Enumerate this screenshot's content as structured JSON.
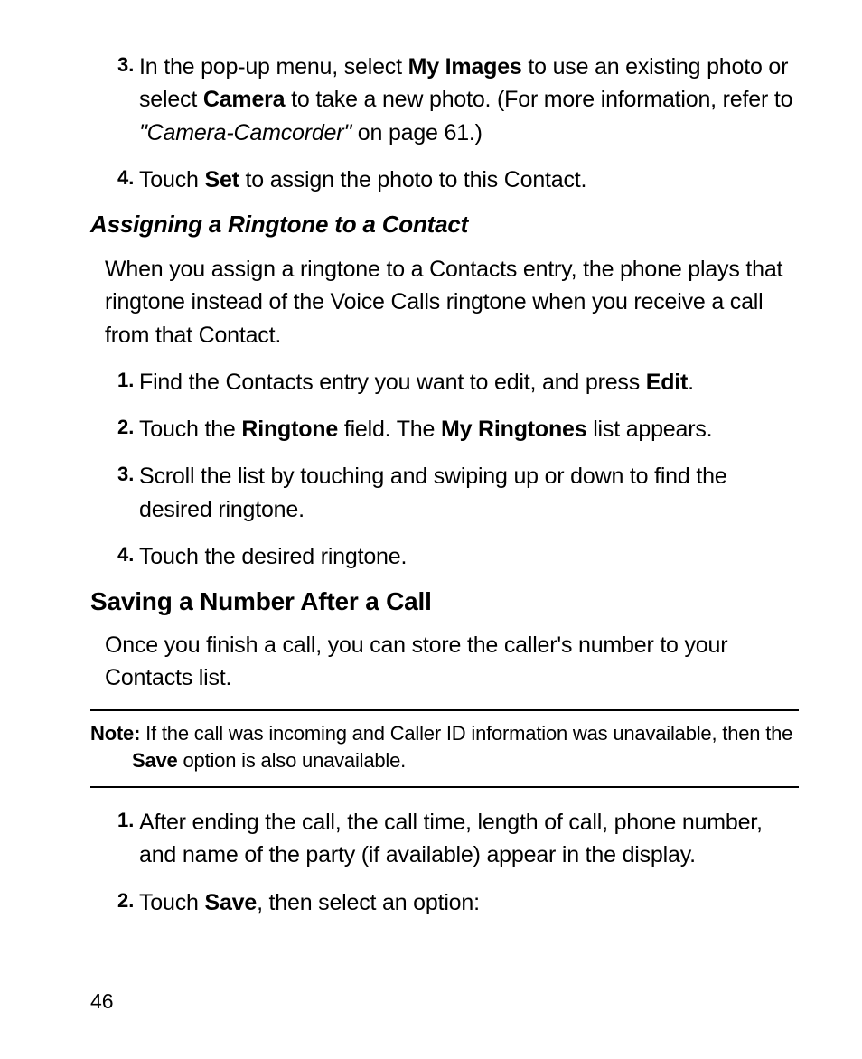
{
  "top_list": [
    {
      "n": "3.",
      "pre": "In the pop-up menu, select ",
      "b1": "My Images",
      "mid1": " to use an existing photo or select ",
      "b2": "Camera",
      "mid2": " to take a new photo. (For more information, refer to ",
      "it": "\"Camera-Camcorder\"",
      "post": "  on page 61.)"
    },
    {
      "n": "4.",
      "pre": "Touch ",
      "b1": "Set",
      "mid1": " to assign the photo to this Contact.",
      "b2": "",
      "mid2": "",
      "it": "",
      "post": ""
    }
  ],
  "subtitle_ringtone": "Assigning a Ringtone to a Contact",
  "para_ringtone": "When you assign a ringtone to a Contacts entry, the phone plays that ringtone instead of the Voice Calls ringtone when you receive a call from that Contact.",
  "ring_list": [
    {
      "n": "1.",
      "pre": "Find the Contacts entry you want to edit, and press ",
      "b1": "Edit",
      "mid1": ".",
      "b2": "",
      "mid2": "",
      "post": ""
    },
    {
      "n": "2.",
      "pre": "Touch the ",
      "b1": "Ringtone",
      "mid1": " field. The ",
      "b2": "My Ringtones",
      "mid2": " list appears.",
      "post": ""
    },
    {
      "n": "3.",
      "pre": "Scroll the list by touching and swiping up or down to find the desired ringtone.",
      "b1": "",
      "mid1": "",
      "b2": "",
      "mid2": "",
      "post": ""
    },
    {
      "n": "4.",
      "pre": "Touch the desired ringtone.",
      "b1": "",
      "mid1": "",
      "b2": "",
      "mid2": "",
      "post": ""
    }
  ],
  "section_save": "Saving a Number After a Call",
  "para_save": "Once you finish a call, you can store the caller's number to your Contacts list.",
  "note": {
    "label": "Note:",
    "pre": " If the call was incoming and Caller ID information was unavailable, then the ",
    "b": "Save",
    "post": " option is also unavailable."
  },
  "save_list": [
    {
      "n": "1.",
      "pre": "After ending the call, the call time, length of call, phone number, and name of the party (if available) appear in the display.",
      "b1": "",
      "mid1": "",
      "post": ""
    },
    {
      "n": "2.",
      "pre": "Touch ",
      "b1": "Save",
      "mid1": ", then select an option:",
      "post": ""
    }
  ],
  "page": "46"
}
